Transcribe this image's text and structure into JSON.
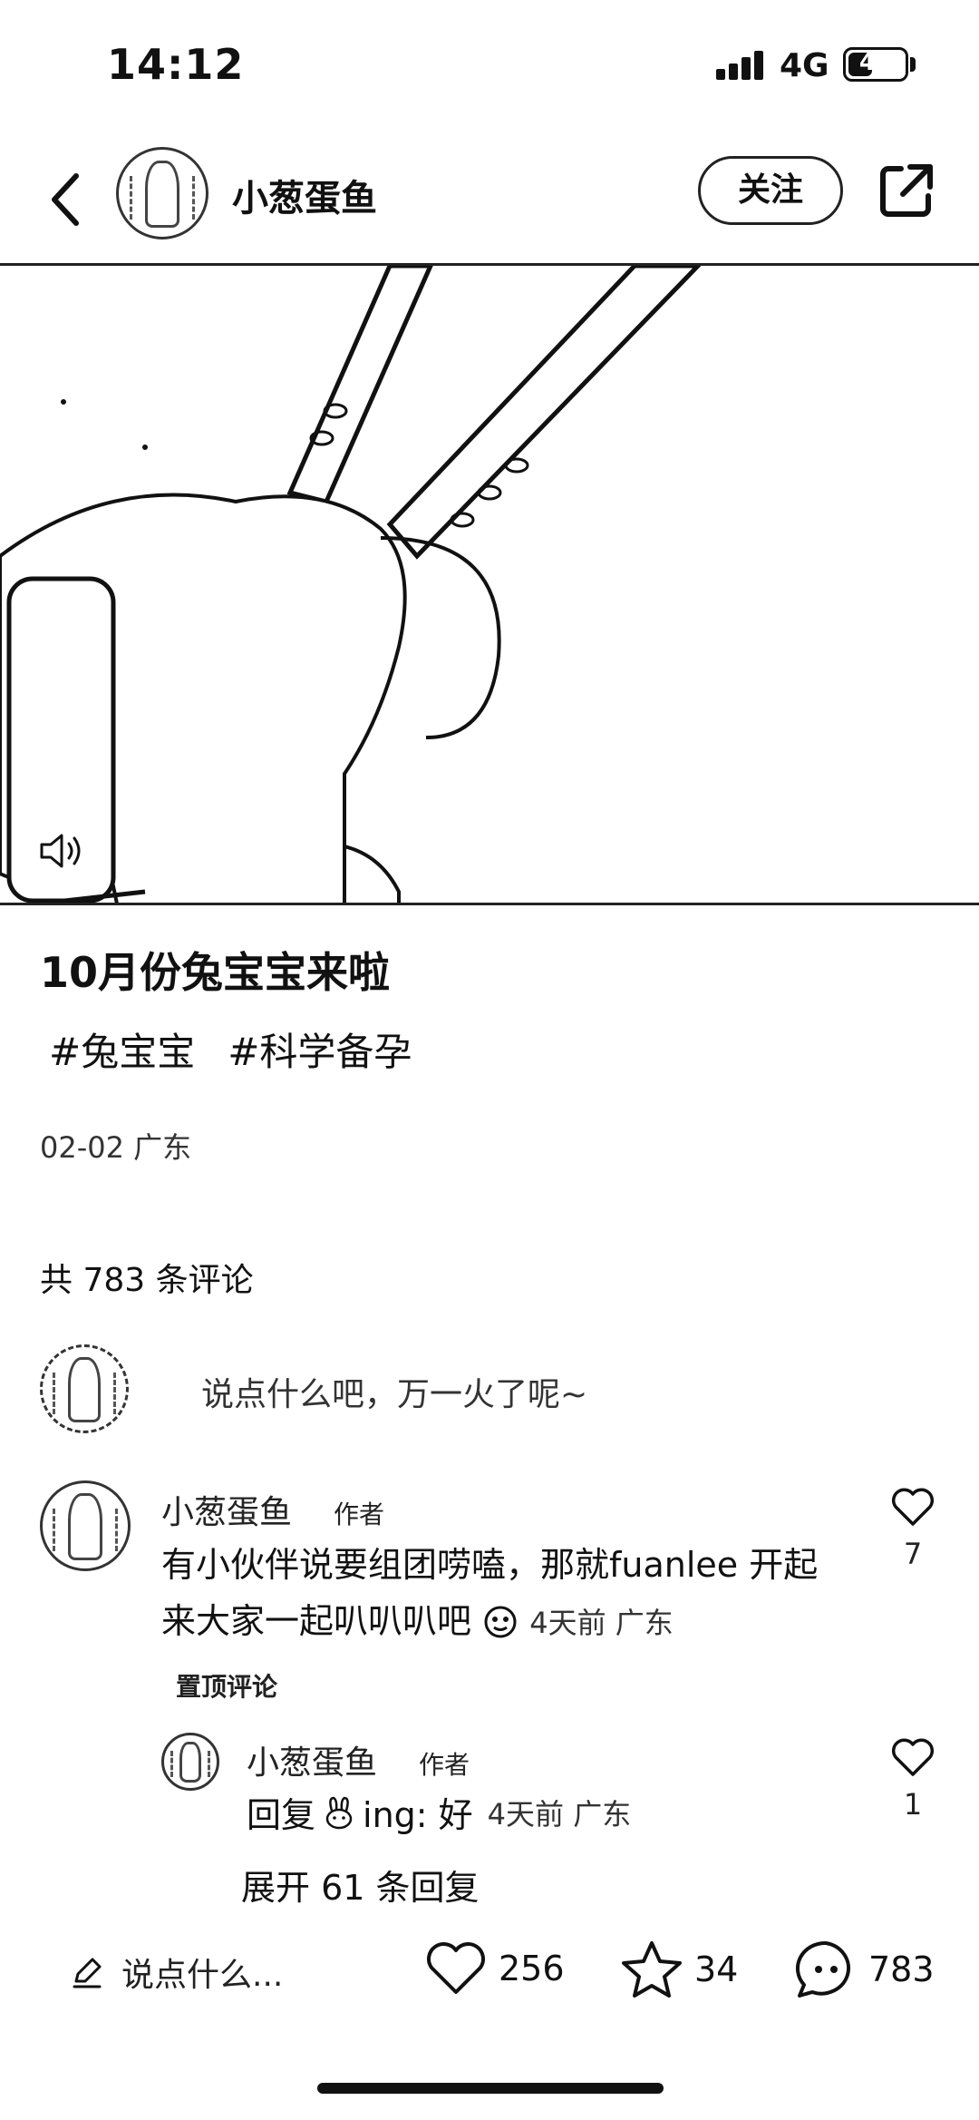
{
  "status_bar": {
    "time": "14:12",
    "network": "4G",
    "battery": "49",
    "battery_level": 0.49,
    "icons": [
      "signal-icon",
      "battery-icon"
    ]
  },
  "header": {
    "author_name": "小葱蛋鱼",
    "follow_label": "关注",
    "icons": [
      "back-icon",
      "share-icon"
    ]
  },
  "post": {
    "title": "10月份兔宝宝来啦",
    "tags": [
      "#兔宝宝",
      "#科学备孕"
    ],
    "meta": "02-02 广东"
  },
  "comments_section": {
    "count_label": "共 783 条评论",
    "input_placeholder": "说点什么吧，万一火了呢~",
    "comments": [
      {
        "author": "小葱蛋鱼",
        "badge": "作者",
        "text": "有小伙伴说要组团唠嗑，那就fuanlee  开起来大家一起叭叭叭吧",
        "emoji": "face-emoji-icon",
        "meta": "4天前 广东",
        "pinned_label": "置顶评论",
        "likes": "7"
      }
    ],
    "reply": {
      "author": "小葱蛋鱼",
      "badge": "作者",
      "prefix": "回复",
      "target": "ing: 好",
      "meta": "4天前 广东",
      "likes": "1"
    },
    "expand_label": "展开 61 条回复"
  },
  "bottom_bar": {
    "input_label": "说点什么...",
    "likes": "256",
    "collects": "34",
    "comments": "783"
  }
}
